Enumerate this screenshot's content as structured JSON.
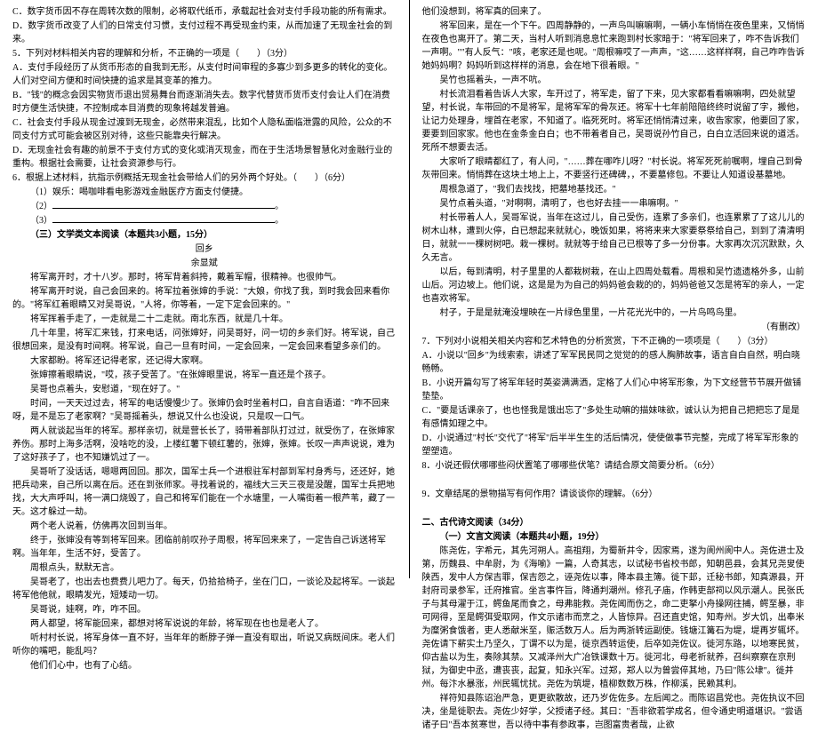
{
  "left": {
    "optC": "C．数字货币因不存在周转次数的限制，必将取代纸币，承载起社会对支付手段功能的所有需求。",
    "optD": "D．数字货币改变了人们的日常支付习惯，支付过程不再受现金约束，从而加速了无现金社会的到来。",
    "q5": "5．下列对材料相关内容的理解和分析，不正确的一项是（　　）（3分）",
    "q5A": "A．支付手段经历了从货币形态的自我到无形，从支付时间审程的多寡少到多更多的转化的变化。人们对空间方便和时间快捷的追求是其变革的推力。",
    "q5B": "B．\"钱\"的概念会因实物货币退出贸易舞台而逐渐消失去。数字代替货币货币支付会让人们在消费时方便生活快捷，不控制成本目消费的现象将越发普遍。",
    "q5C": "C．社会支付手段从现金过渡到无现金，必然带来混乱，比如个人隐私面临泄露的风险，公众的不同支付方式可能会被区别对待，这些只能靠央行解决。",
    "q5D": "D．无现金社会有趣的前景不于支付方式的变化或消灭现金，而在于生活场景智慧化对金融行业的重构。根据社会需要，让社会资源参与行。",
    "q6": "6．根据上述材料，抗指示例概括无现金社会带给人们的另外两个好处。（　　）（6分）",
    "q6_1": "（1）娱乐：喝咖啡看电影游戏金融医疗方面支付便捷。",
    "q6_2": "（2）",
    "q6_3": "（3）",
    "sec3_title": "（三）文学类文本阅读（本题共3小题，15分）",
    "story_title": "回乡",
    "story_author": "余显斌",
    "p1": "将军离开时，才十八岁。那时，将军背着斜挎，戴着军帽，很精神。也很帅气。",
    "p2": "将军离开时说，自己会回来的。将军拉着张婶的手说：\"大娘，你找了我，到时我会回来看你的。\"将军红着眼睛又对吴哥说，\"人将，你等着，一定下定会回来的。\"",
    "p3": "将军挥着手走了，一走就是二十二走就。南北东西，就是几十年。",
    "p4": "几十年里，将军汇来钱，打来电话，问张婶好，问吴哥好，问一切的乡亲们好。将军说，自己很想回来，是没有时间啊。将军说，自己一旦有时间，一定会回来，一定会回来看望多亲们的。",
    "p5": "大家都盼。将军还记得老家，还记得大家啊。",
    "p6": "张婶擦着眼睛说，\"哎，孩子受苦了。\"在张婶眼里说，将军一直还是个孩子。",
    "p7": "吴哥也点着头，安慰道，\"现在好了。\"",
    "p8": "时间，一天天过过去，将军的电话慢慢少了。张婶仍会时坐着村口，自言自语道：\"咋不回来呀，是不是忘了老家啊？\"吴哥摇着头，想说又什么也没说，只是叹一口气。",
    "p9": "两人就谈起当年的将军。那样亲切，就是营长长了，骑带着部队打过过，就受伤了，在张婶家养伤。那时上海多活啊，没啥吃的没，上楼红薯下顿红薯的，张婶，张婶。长叹一声声说说，难为了这好孩子了，也不知嫌饥过了一。",
    "p10": "吴哥听了没话话，嗯嗯两回回。那次，国军士兵一个进根驻军村部到军村身秀与，还还好，她把兵动来，自己所以离在后。还在到张师家。寻找着说的，福线大三天三夜是没醒，国军士兵把地找，大大声呼叫，将一满口烧毁了，自己和将军们能在一个水塘里，一人嘴街着一根芦苇，藏了一天。这才躲过一劫。",
    "p11": "两个老人说着，仿佛再次回到当年。",
    "p12": "终于，张婶没有等到将军回来。团临前前叹孙子周根，将军回来来了，一定告自己诉送将军啊。当年年，生活不好，受苦了。",
    "p13": "周根点头，默默无言。",
    "p14": "吴哥老了，也出去也费费儿吧力了。每天，仍拾拾椅子，坐在门口，一谈论及起将军。一谈起将军他他就，眼睛发光，短矮动一切。",
    "p15": "吴哥说，娃啊，咋，咋不回。",
    "p16": "两人都望，将军能回来，都想对将军说说的年龄，将军现在也也是老人了。",
    "p17": "听村村长说，将军身体一直不好，当年年的断脖子弹一直没有取出，听说又病既间床。老人们听你的嘴吧，能乱吗？",
    "p18": "他们们心中，也有了心结。"
  },
  "right": {
    "p1": "他们没想到，将军真的回来了。",
    "p2": "将军回来，是在一个下午。四周静静的，一声鸟叫嘛嘛啊，一辆小车悄悄在夜色里来，又悄悄在夜色也离开了。第二天，当村人听到消息息忙来跑到村长家暗于：\"将军回来了，咋不告诉我们一声啊。\"\"有人反气：\"咳，老家还是也呢。\"周根嘛哎了一声声，\"这……这样样啊，自己咋咋告诉她妈妈啊？妈妈听到这样样的消息，会在地下很着眼。\"",
    "p3": "吴竹也摇着头，一声不吭。",
    "p4": "村长流泪看着告诉人大家，车开过了，将军走，留了下来，见大家都看看嘛嘛啊，四处就望望，村长说，车带回的不是将军，是将军军的骨灰还。将军十七年前陪陪终终时说留了字，搬他，让记力处理身，埋首在老家，不知道了。临死死时。将军还悄悄清过来，收告家家，他要回了家，要要到回家家。他也在金条金白白；也不带着者自己，吴哥说孙竹自己，白白立活回来说的道活。死所不想要去活。",
    "p5": "大家听了眼睛都红了，有人问，\"……葬在哪咋儿呀？\"村长说。将军死死前嘱啊，埋自己到骨灰带回来。悄悄葬在这块土地上上，不要竖行还碑碑，，不要墓修包。不要让人知道设基墓地。",
    "p6": "周根急道了，\"我们去找找，把墓地基找还。\"",
    "p7": "吴竹点着头道，\"对啊啊，清明了，也也好去挂一一串嘛啊。\"",
    "p8": "村长带着人人，吴哥军说，当年在这过儿，自己受伤，连累了多亲们，也连累累了了这儿儿的树木山林，遭到火停，白已想起来就就心，晚饭如果，将将来来大家要祭祭给自己，到到了清清明日，就就一一棵树树吧。栽一棵树。就就等于给自己已根等了多一分份事。大家再次沉沉默默，久久无言。",
    "p9": "以后，每到清明，村子里里的人都栽树栽，在山上四周处载看。周根和吴竹遗遗格外多，山前山后。河边坡上。他们说，这是是为为自己的妈妈爸会栽的的，妈妈爸爸又怎是将军的亲人，一定也喜欢将军。",
    "p10": "村子，于是是就淹没埋映在一片绿色里里，一片花光光中的，一片鸟鸣鸟里。",
    "p10_r": "（有删改）",
    "q7": "7．下列对小说相关相关内容和艺术特色的分析赏赏，下不正确的一项项是（　　）（3分）",
    "q7A": "A．小说以\"回乡\"为线索索，讲述了军军民民同之觉觉的的感人胸肺故事，语言自白自然，明白晓畅畅。",
    "q7B": "B．小说开篇勾写了将军年轻时英姿满满洒，定格了人们心中将军形象，为下文经营节节展开做铺垫垫。",
    "q7C": "C．\"要是话课亲了，也也怪我是饿出忘了\"多处生动嘛的描妹味欲，诚认认为把自己把把忘了是是有感情如理之中。",
    "q7D": "D．小说通过\"村长\"交代了\"将军\"后半半生生的活后情况，使使做事节完整，完成了将军军形象的塑塑造。",
    "q8": "8．小说还假伏哪哪些闷伏置笔了哪哪些伏笔？请结合原文简要分析。（6分）",
    "q9": "9．文章结尾的景物描写有何作用？请谈谈你的理解。（6分）",
    "sec2": "二、古代诗文阅读（34分）",
    "sec2_1": "（一）文言文阅读（本题共4小题，19分）",
    "wp1": "陈尧佐，字希元，其先河朔人。高祖翔，为蜀新井令，因家焉，遂为阆州阆中人。尧佐进士及第，历魏县、中牟尉，为《海喻》一篇，人奇其志，以试秘书省校书郎，知朝邑县，会其兄尧叟使陕西，发中人方保吉罪，保吉怨之，诬尧佐以事，降本县主簿。徙下邽，迁秘书郎，知真源县，开封府司录参军，迁府推官。坐言事忤旨，降通判潮州。修孔子庙，作韩吏部祠以风示潮人。民张氏子与其母濯于江，鳄鱼尾而食之，母弗能救。尧佐闻而伤之，命二吏拏小舟操网往捕，鳄至暴，非可网得，至是鳄弭受取网，作文示诸市而烹之，人皆惊异。召还直史馆，知寿州。岁大饥，出奉米为糜粥食饿者，吏人悉献米至，赈活数万人。后为两浙转运副使。钱塘江篝石为堤，堤再岁辄坏。尧佐请下薪实土乃坚久，丁谓不以为是，徙京西转运使，后卒如尧佐议。徙河东路，以地寒民贫，仰古盐以为生，奏除其禁。又减泽州大广冶铁课数十万。徙河北，母老祈就养，召纠察察在京刑狱，为御史中丞，遭丧丧，起复，知永兴军。过郑，郑人以为曾尝倅其地，乃曰\"陈公埭\"。徙并州。每汴水暴涨，州民辄忧扰。尧佐为筑堤，植柳数数万株，作柳溪，民赖其利。",
    "wp2": "祥符知县陈诏治严急，更更欲散故，还乃岁佐佐多。左后闻之。而陈诏昌党也。尧佐执议不回决，坐是徙职去。尧佐少好学，父授诸子经。其曰：\"吾非欲若学成名，但令通史明道堪识。\"尝语诸子曰\"吾本贫寒世，吾以待中事有参政事，岂图富贵者哉，止欲"
  }
}
